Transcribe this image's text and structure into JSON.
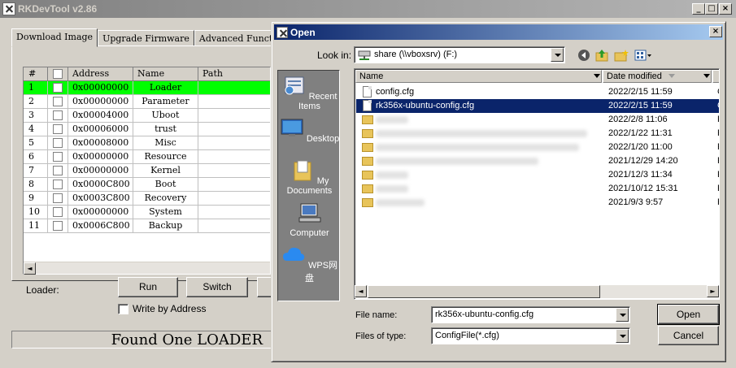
{
  "main": {
    "title": "RKDevTool v2.86",
    "tabs": [
      "Download Image",
      "Upgrade Firmware",
      "Advanced Function"
    ],
    "columns": [
      "#",
      "Address",
      "Name",
      "Path"
    ],
    "rows": [
      {
        "num": "1",
        "address": "0x00000000",
        "name": "Loader"
      },
      {
        "num": "2",
        "address": "0x00000000",
        "name": "Parameter"
      },
      {
        "num": "3",
        "address": "0x00004000",
        "name": "Uboot"
      },
      {
        "num": "4",
        "address": "0x00006000",
        "name": "trust"
      },
      {
        "num": "5",
        "address": "0x00008000",
        "name": "Misc"
      },
      {
        "num": "6",
        "address": "0x00000000",
        "name": "Resource"
      },
      {
        "num": "7",
        "address": "0x00000000",
        "name": "Kernel"
      },
      {
        "num": "8",
        "address": "0x0000C800",
        "name": "Boot"
      },
      {
        "num": "9",
        "address": "0x0003C800",
        "name": "Recovery"
      },
      {
        "num": "10",
        "address": "0x00000000",
        "name": "System"
      },
      {
        "num": "11",
        "address": "0x0006C800",
        "name": "Backup"
      }
    ],
    "highlight_color": "#00ff00",
    "loader_label": "Loader:",
    "run_label": "Run",
    "switch_label": "Switch",
    "write_by_address_label": "Write by Address",
    "status": "Found One LOADER"
  },
  "dialog": {
    "title": "Open",
    "look_in_label": "Look in:",
    "look_in_value": "share (\\\\vboxsrv) (F:)",
    "places": [
      "Recent Items",
      "Desktop",
      "My Documents",
      "Computer",
      "WPS网盘"
    ],
    "columns": [
      "Name",
      "Date modified"
    ],
    "files": [
      {
        "name": "config.cfg",
        "date": "2022/2/15 11:59",
        "type": "C",
        "kind": "file",
        "selected": false
      },
      {
        "name": "rk356x-ubuntu-config.cfg",
        "date": "2022/2/15 11:59",
        "type": "C",
        "kind": "file",
        "selected": true
      },
      {
        "name": "",
        "date": "2022/2/8 11:06",
        "type": "F",
        "kind": "folder",
        "selected": false
      },
      {
        "name": "",
        "date": "2022/1/22 11:31",
        "type": "F",
        "kind": "folder",
        "selected": false
      },
      {
        "name": "",
        "date": "2022/1/20 11:00",
        "type": "F",
        "kind": "folder",
        "selected": false
      },
      {
        "name": "",
        "date": "2021/12/29 14:20",
        "type": "F",
        "kind": "folder",
        "selected": false
      },
      {
        "name": "",
        "date": "2021/12/3 11:34",
        "type": "F",
        "kind": "folder",
        "selected": false
      },
      {
        "name": "",
        "date": "2021/10/12 15:31",
        "type": "F",
        "kind": "folder",
        "selected": false
      },
      {
        "name": "",
        "date": "2021/9/3 9:57",
        "type": "F",
        "kind": "folder",
        "selected": false
      }
    ],
    "file_name_label": "File name:",
    "file_name_value": "rk356x-ubuntu-config.cfg",
    "file_type_label": "Files of type:",
    "file_type_value": "ConfigFile(*.cfg)",
    "open_label": "Open",
    "cancel_label": "Cancel",
    "selection_color": "#0a246a"
  }
}
